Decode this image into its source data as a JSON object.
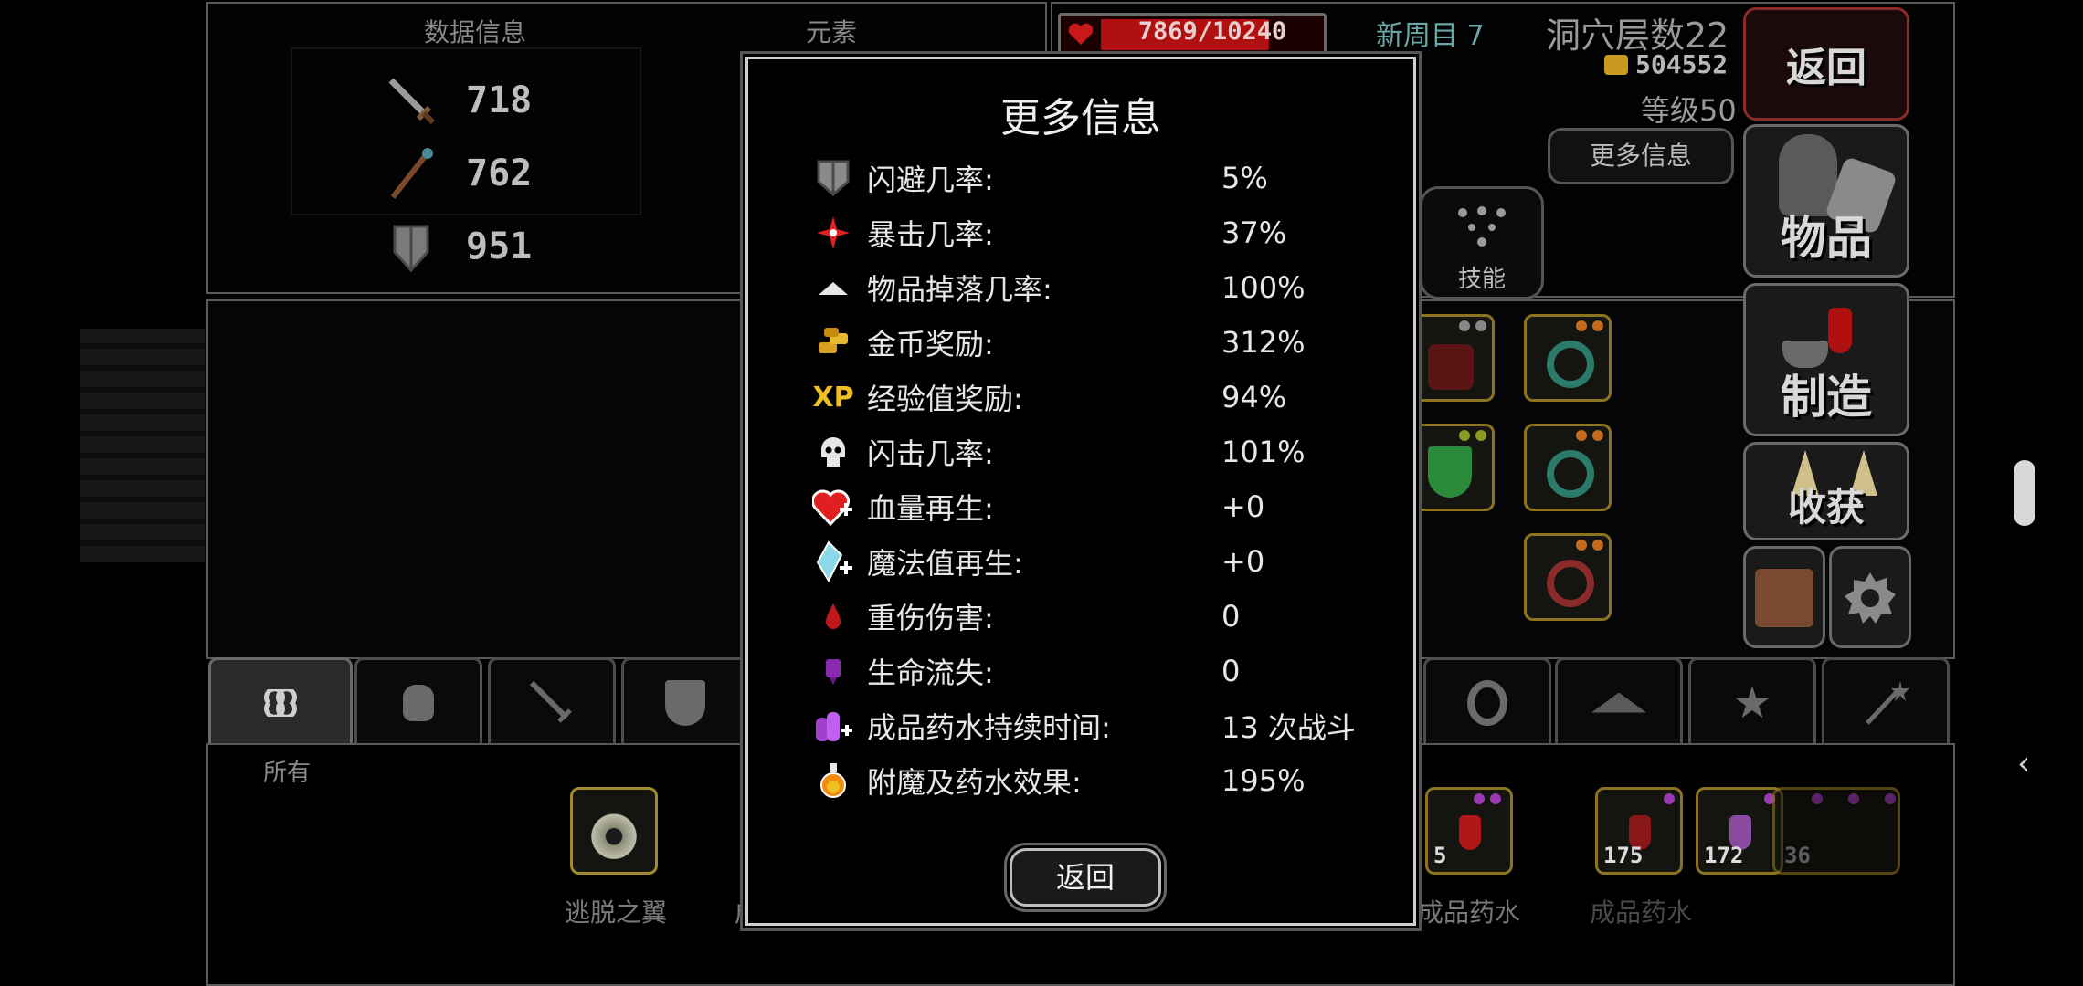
{
  "stats_panel": {
    "header_left": "数据信息",
    "header_right": "元素",
    "attack": "718",
    "magic": "762",
    "defense": "951"
  },
  "hud": {
    "hp": "7869/10240",
    "hp_fraction": 0.768,
    "new_cycle": "新周目 7",
    "cave_floor": "洞穴层数22",
    "gold": "504552",
    "level": "等级50",
    "more_info_button": "更多信息",
    "skill_label": "技能"
  },
  "side_menu": {
    "back": "返回",
    "items": "物品",
    "craft": "制造",
    "harvest": "收获"
  },
  "tabs": {
    "all_label": "所有"
  },
  "inventory": {
    "item1_name": "逃脱之翼",
    "item2_partial": "成",
    "item3_count": "5",
    "item3_name": "成品药水",
    "item4_count": "175",
    "item5_count": "172",
    "item6_count": "36",
    "item6_name": "成品药水"
  },
  "modal": {
    "title": "更多信息",
    "rows": [
      {
        "label": "闪避几率:",
        "value": "5%"
      },
      {
        "label": "暴击几率:",
        "value": "37%"
      },
      {
        "label": "物品掉落几率:",
        "value": "100%"
      },
      {
        "label": "金币奖励:",
        "value": "312%"
      },
      {
        "label": "经验值奖励:",
        "value": "94%"
      },
      {
        "label": "闪击几率:",
        "value": "101%"
      },
      {
        "label": "血量再生:",
        "value": "+0"
      },
      {
        "label": "魔法值再生:",
        "value": "+0"
      },
      {
        "label": "重伤伤害:",
        "value": "0"
      },
      {
        "label": "生命流失:",
        "value": "0"
      },
      {
        "label": "成品药水持续时间:",
        "value": "13 次战斗"
      },
      {
        "label": "附魔及药水效果:",
        "value": "195%"
      }
    ],
    "back_button": "返回",
    "icon_xp_text": "XP"
  },
  "colors": {
    "hp_red": "#b01010",
    "gold_border": "#8a7420",
    "cycle_teal": "#6aa7a7"
  }
}
